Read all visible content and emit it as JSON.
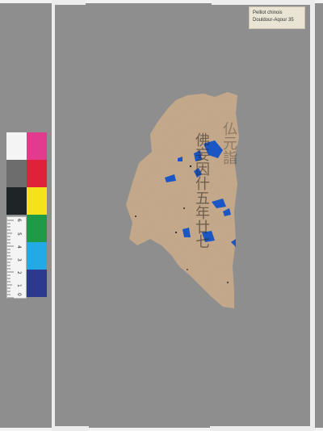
{
  "label": {
    "line1": "Pelliot chinois",
    "line2": "Douldour-Aqour 35"
  },
  "colors": {
    "background": "#8e8e8e",
    "paper": "#c9ab8d",
    "restoration_blue": "#1a56c4",
    "swatches": [
      "#f4f4f4",
      "#e23a8c",
      "#6d6d6d",
      "#e0213a",
      "#1f2426",
      "#f4e21a",
      "#4a4a4a",
      "#1f9a46",
      "#d8d8d8",
      "#22a9e6",
      "#cfcfcf",
      "#2b3a8e"
    ]
  },
  "ruler": {
    "ticks": [
      "0",
      "1",
      "2",
      "3",
      "4",
      "5",
      "6"
    ]
  },
  "fragment": {
    "script_columns": [
      "佛妄因什五年廿七",
      "仏元詣"
    ]
  }
}
